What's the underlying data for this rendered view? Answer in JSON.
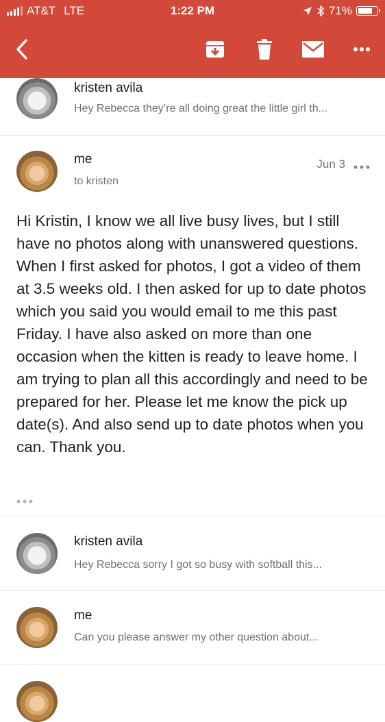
{
  "status_bar": {
    "carrier": "AT&T",
    "network": "LTE",
    "time": "1:22 PM",
    "battery": "71%"
  },
  "toolbar": {
    "back_icon": "chevron-left",
    "archive_icon": "archive",
    "trash_icon": "trash",
    "mail_icon": "envelope",
    "more_icon": "more-horizontal"
  },
  "thread": [
    {
      "sender": "kristen avila",
      "snippet": "Hey Rebecca they’re all doing great the little girl th..."
    },
    {
      "sender": "me",
      "to": "to kristen",
      "date": "Jun 3",
      "body": "Hi Kristin, I know we all live busy lives, but I still have no photos along with unanswered questions. When I first asked for photos, I got a video of them at 3.5 weeks old. I then asked for up to date photos which you said you would email to me this past Friday. I have also asked on more than one occasion when the kitten is ready to leave home. I am trying to plan all this accordingly and need to be prepared for her. Please let me know the pick up date(s). And also send up to date photos when you can. Thank you."
    },
    {
      "sender": "kristen avila",
      "snippet": "Hey Rebecca sorry I got so busy with softball this..."
    },
    {
      "sender": "me",
      "snippet": "Can you please answer my other question about..."
    }
  ],
  "colors": {
    "header": "#d2493a",
    "snippet_text": "#707070"
  }
}
